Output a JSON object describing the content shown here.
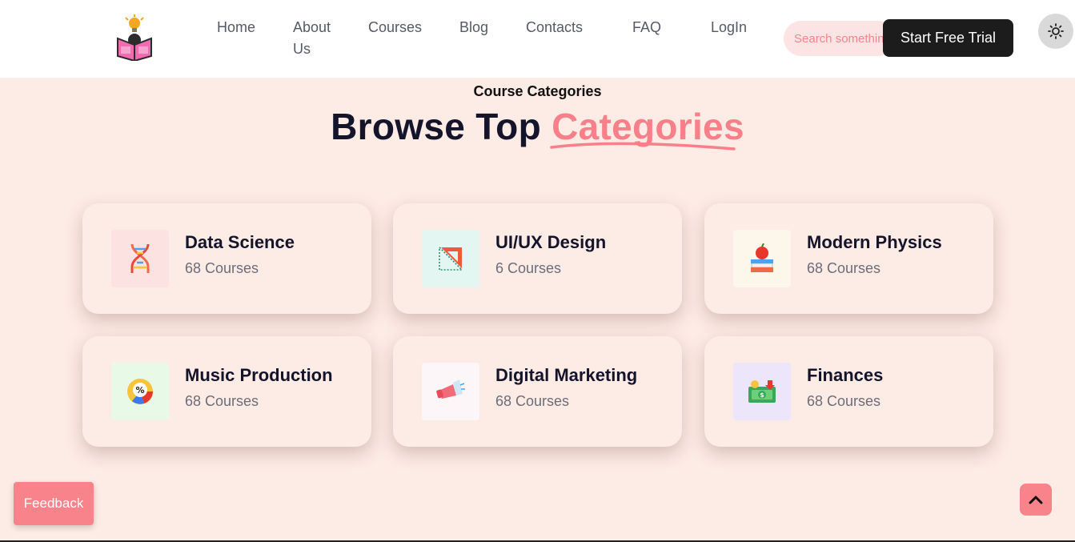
{
  "nav": {
    "links": [
      "Home",
      "About Us",
      "Courses",
      "Blog",
      "Contacts",
      "FAQ",
      "LogIn"
    ],
    "search_placeholder": "Search something...",
    "trial_label": "Start Free Trial"
  },
  "section": {
    "subtitle": "Course Categories",
    "title_prefix": "Browse Top ",
    "title_accent": "Categories"
  },
  "categories": [
    {
      "title": "Data Science",
      "count": "68 Courses",
      "icon": "dna-icon",
      "tint": "#fde2e2"
    },
    {
      "title": "UI/UX Design",
      "count": "6 Courses",
      "icon": "set-square-icon",
      "tint": "#e3f6f2"
    },
    {
      "title": "Modern Physics",
      "count": "68 Courses",
      "icon": "apple-books-icon",
      "tint": "#fdf6ea"
    },
    {
      "title": "Music Production",
      "count": "68 Courses",
      "icon": "percent-chart-icon",
      "tint": "#e8f9e8"
    },
    {
      "title": "Digital Marketing",
      "count": "68 Courses",
      "icon": "megaphone-icon",
      "tint": "#fdf6f8"
    },
    {
      "title": "Finances",
      "count": "68 Courses",
      "icon": "money-icon",
      "tint": "#ede6fb"
    }
  ],
  "feedback_label": "Feedback",
  "colors": {
    "accent": "#f7808a",
    "dark_button": "#1c1c1c",
    "background": "#fdebe5"
  }
}
